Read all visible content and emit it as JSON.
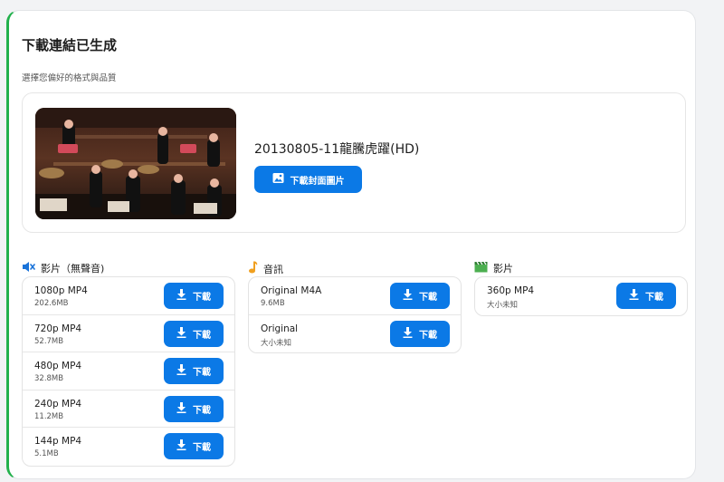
{
  "header": {
    "title": "下載連結已生成",
    "subtitle": "選擇您偏好的格式與品質"
  },
  "video": {
    "title": "20130805-11龍騰虎躍(HD)",
    "cover_button_label": "下載封面圖片"
  },
  "columns": [
    {
      "heading": "影片（無聲音)",
      "icon": "muted-speaker-icon",
      "items": [
        {
          "name": "1080p MP4",
          "size": "202.6MB",
          "button": "下載"
        },
        {
          "name": "720p MP4",
          "size": "52.7MB",
          "button": "下載"
        },
        {
          "name": "480p MP4",
          "size": "32.8MB",
          "button": "下載"
        },
        {
          "name": "240p MP4",
          "size": "11.2MB",
          "button": "下載"
        },
        {
          "name": "144p MP4",
          "size": "5.1MB",
          "button": "下載"
        }
      ]
    },
    {
      "heading": "音訊",
      "icon": "music-note-icon",
      "items": [
        {
          "name": "Original M4A",
          "size": "9.6MB",
          "button": "下載"
        },
        {
          "name": "Original",
          "size": "大小未知",
          "button": "下載"
        }
      ]
    },
    {
      "heading": "影片",
      "icon": "clapperboard-icon",
      "items": [
        {
          "name": "360p MP4",
          "size": "大小未知",
          "button": "下載"
        }
      ]
    }
  ],
  "colors": {
    "accent": "#0b79e6",
    "card_border_left": "#22b14c"
  }
}
